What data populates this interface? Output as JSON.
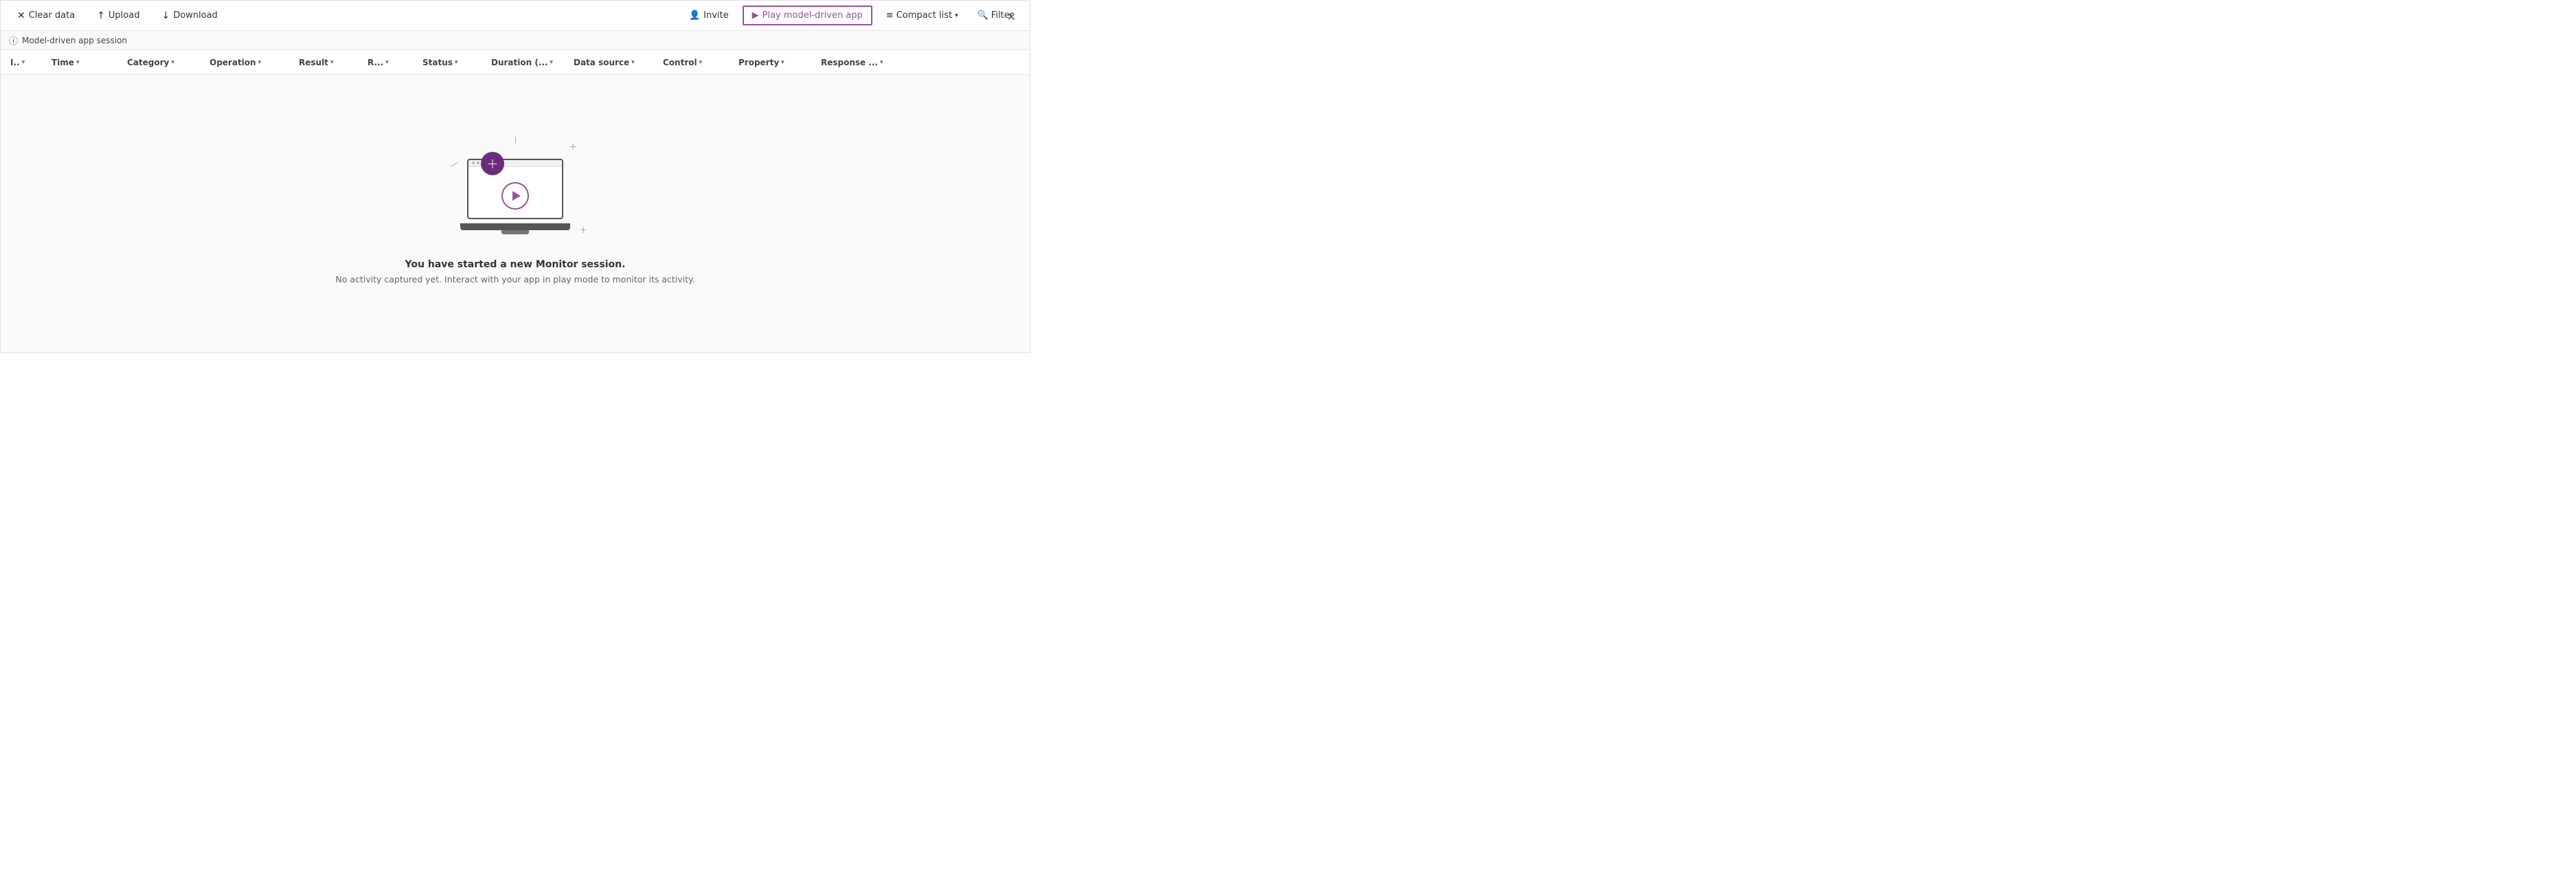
{
  "toolbar": {
    "clear_data_label": "Clear data",
    "upload_label": "Upload",
    "download_label": "Download",
    "invite_label": "Invite",
    "play_model_driven_label": "Play model-driven app",
    "compact_list_label": "Compact list",
    "filter_label": "Filter"
  },
  "session_bar": {
    "label": "Model-driven app session"
  },
  "columns": [
    {
      "id": "col-id",
      "label": "I.."
    },
    {
      "id": "col-time",
      "label": "Time"
    },
    {
      "id": "col-category",
      "label": "Category"
    },
    {
      "id": "col-operation",
      "label": "Operation"
    },
    {
      "id": "col-result",
      "label": "Result"
    },
    {
      "id": "col-r",
      "label": "R..."
    },
    {
      "id": "col-status",
      "label": "Status"
    },
    {
      "id": "col-duration",
      "label": "Duration (..."
    },
    {
      "id": "col-datasource",
      "label": "Data source"
    },
    {
      "id": "col-control",
      "label": "Control"
    },
    {
      "id": "col-property",
      "label": "Property"
    },
    {
      "id": "col-response",
      "label": "Response ..."
    }
  ],
  "empty_state": {
    "title": "You have started a new Monitor session.",
    "subtitle": "No activity captured yet. Interact with your app in play mode to monitor its activity."
  }
}
